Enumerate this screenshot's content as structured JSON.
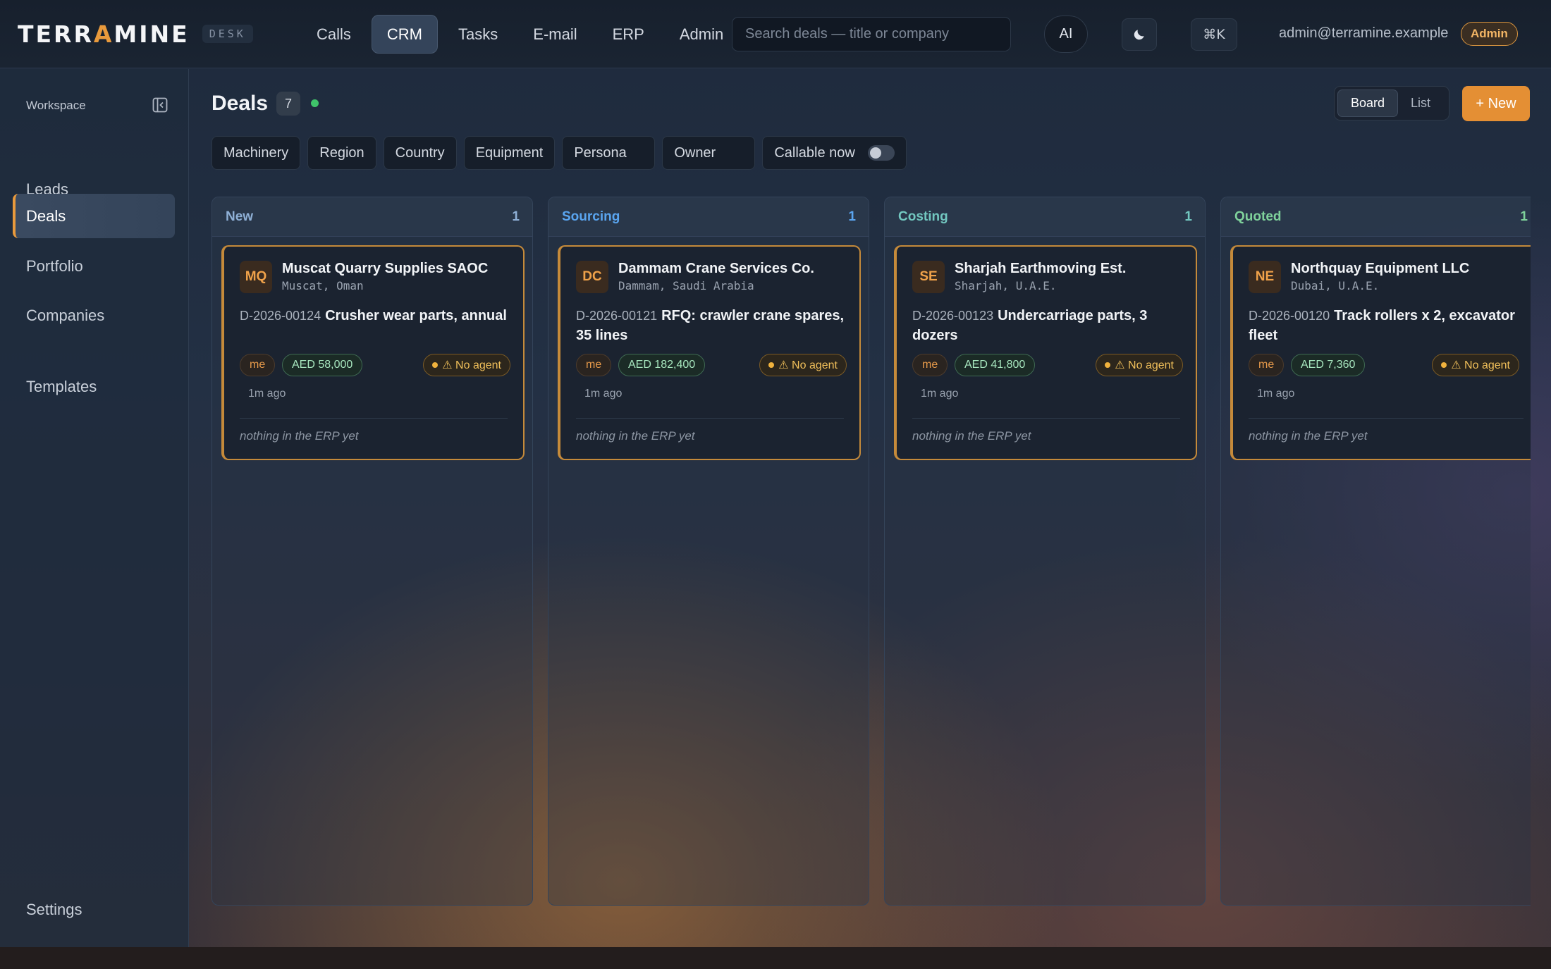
{
  "brand": {
    "wordmark_left": "TERR",
    "wordmark_accent": "A",
    "wordmark_right": "MINE",
    "badge": "DESK"
  },
  "nav": {
    "items": [
      {
        "label": "Calls",
        "active": false
      },
      {
        "label": "CRM",
        "active": true
      },
      {
        "label": "Tasks",
        "active": false
      },
      {
        "label": "E-mail",
        "active": false
      },
      {
        "label": "ERP",
        "active": false
      },
      {
        "label": "Admin",
        "active": false
      }
    ]
  },
  "search": {
    "placeholder": "Search deals — title or company",
    "value": ""
  },
  "topbar": {
    "ai_label": "AI",
    "theme_icon": "moon-icon",
    "command_label": "⌘K",
    "user_email": "admin@terramine.example",
    "role_badge": "Admin"
  },
  "sidebar": {
    "heading": "Workspace",
    "collapse_icon": "sidebar-collapse-icon",
    "items": [
      {
        "label": "Leads",
        "active": false
      },
      {
        "label": "Deals",
        "active": true
      },
      {
        "label": "Portfolio",
        "active": false
      },
      {
        "label": "Companies",
        "active": false
      },
      {
        "label": "Templates",
        "active": false
      }
    ],
    "settings_label": "Settings"
  },
  "page": {
    "title": "Deals",
    "count": "7",
    "view_options": [
      "Board",
      "List"
    ],
    "active_view": "Board",
    "new_button": "+ New"
  },
  "filters": [
    "Machinery",
    "Region",
    "Country",
    "Equipment",
    "Persona",
    "Owner"
  ],
  "callable_toggle": {
    "label": "Callable now",
    "on": false
  },
  "columns": [
    {
      "name": "New",
      "count": "1",
      "color": "#8fb0d6",
      "card": {
        "initials": "MQ",
        "company": "Muscat Quarry Supplies SAOC",
        "location": "Muscat, Oman",
        "deal_id": "D-2026-00124",
        "title": "Crusher wear parts, annual",
        "owner": "me",
        "amount": "AED 58,000",
        "agent": "⚠ No agent",
        "updated": "1m ago",
        "erp_note": "nothing in the ERP yet"
      }
    },
    {
      "name": "Sourcing",
      "count": "1",
      "color": "#5aa5f0",
      "card": {
        "initials": "DC",
        "company": "Dammam Crane Services Co.",
        "location": "Dammam, Saudi Arabia",
        "deal_id": "D-2026-00121",
        "title": "RFQ: crawler crane spares, 35 lines",
        "owner": "me",
        "amount": "AED 182,400",
        "agent": "⚠ No agent",
        "updated": "1m ago",
        "erp_note": "nothing in the ERP yet"
      }
    },
    {
      "name": "Costing",
      "count": "1",
      "color": "#72c7c0",
      "card": {
        "initials": "SE",
        "company": "Sharjah Earthmoving Est.",
        "location": "Sharjah, U.A.E.",
        "deal_id": "D-2026-00123",
        "title": "Undercarriage parts, 3 dozers",
        "owner": "me",
        "amount": "AED 41,800",
        "agent": "⚠ No agent",
        "updated": "1m ago",
        "erp_note": "nothing in the ERP yet"
      }
    },
    {
      "name": "Quoted",
      "count": "1",
      "color": "#7fd29b",
      "card": {
        "initials": "NE",
        "company": "Northquay Equipment LLC",
        "location": "Dubai, U.A.E.",
        "deal_id": "D-2026-00120",
        "title": "Track rollers x 2, excavator fleet",
        "owner": "me",
        "amount": "AED 7,360",
        "agent": "⚠ No agent",
        "updated": "1m ago",
        "erp_note": "nothing in the ERP yet"
      }
    }
  ]
}
